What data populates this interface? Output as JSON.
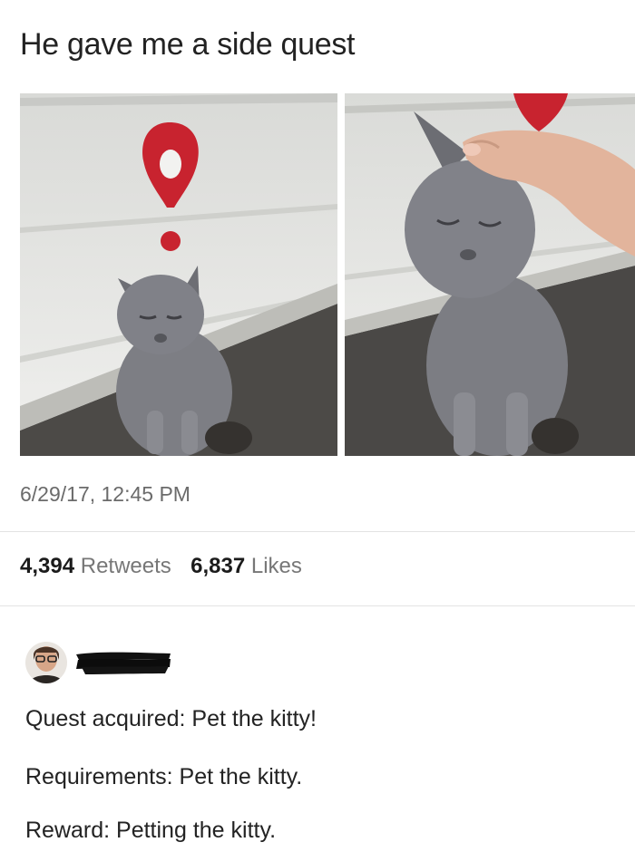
{
  "tweet": {
    "text": "He gave me a side quest",
    "timestamp": "6/29/17, 12:45 PM"
  },
  "stats": {
    "retweets_count": "4,394",
    "retweets_label": "Retweets",
    "likes_count": "6,837",
    "likes_label": "Likes"
  },
  "reply": {
    "lines": [
      "Quest acquired: Pet the kitty!",
      "Requirements: Pet the kitty.",
      "Reward: Petting the kitty."
    ]
  },
  "colors": {
    "quest_marker": "#c8232f",
    "cat": "#7d7e84",
    "wall": "#e6e6e3",
    "ground": "#4a4846"
  }
}
